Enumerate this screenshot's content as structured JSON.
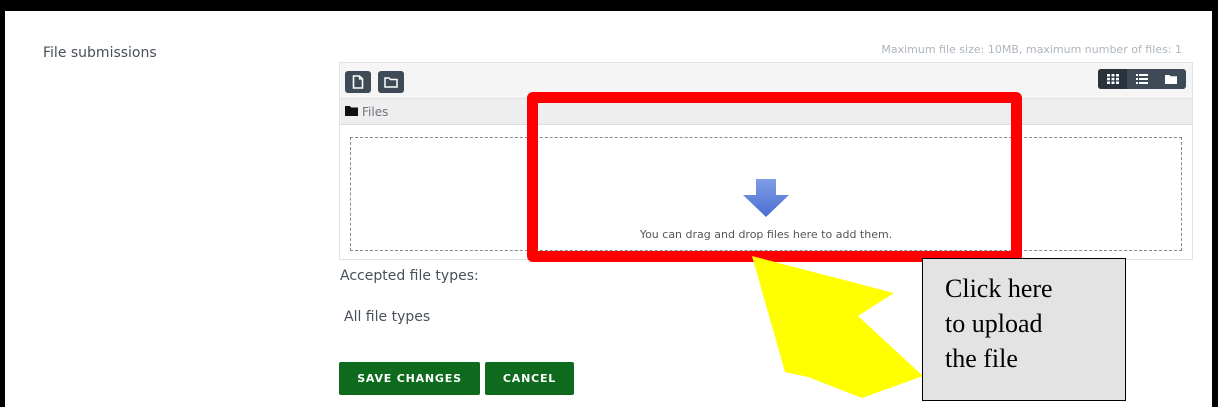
{
  "form": {
    "label": "File submissions",
    "max_info": "Maximum file size: 10MB, maximum number of files: 1"
  },
  "filepicker": {
    "toolbar": {
      "add_icon": "file-icon",
      "folder_icon": "folder-outline-icon",
      "view_icons": [
        "grid-icon",
        "list-icon",
        "folder-icon"
      ]
    },
    "path_label": "Files",
    "drop_text": "You can drag and drop files here to add them."
  },
  "accepted": {
    "label": "Accepted file types:",
    "value": "All file types"
  },
  "buttons": {
    "save": "SAVE CHANGES",
    "cancel": "CANCEL"
  },
  "annotation": {
    "callout_lines": [
      "Click here",
      "to upload",
      "the file"
    ],
    "box_color": "#ff0000",
    "arrow_color": "#ffff00"
  },
  "colors": {
    "button_green": "#0e6b1d",
    "toolbar_dark": "#3e4a56",
    "drop_arrow": "#5b7fd6"
  }
}
